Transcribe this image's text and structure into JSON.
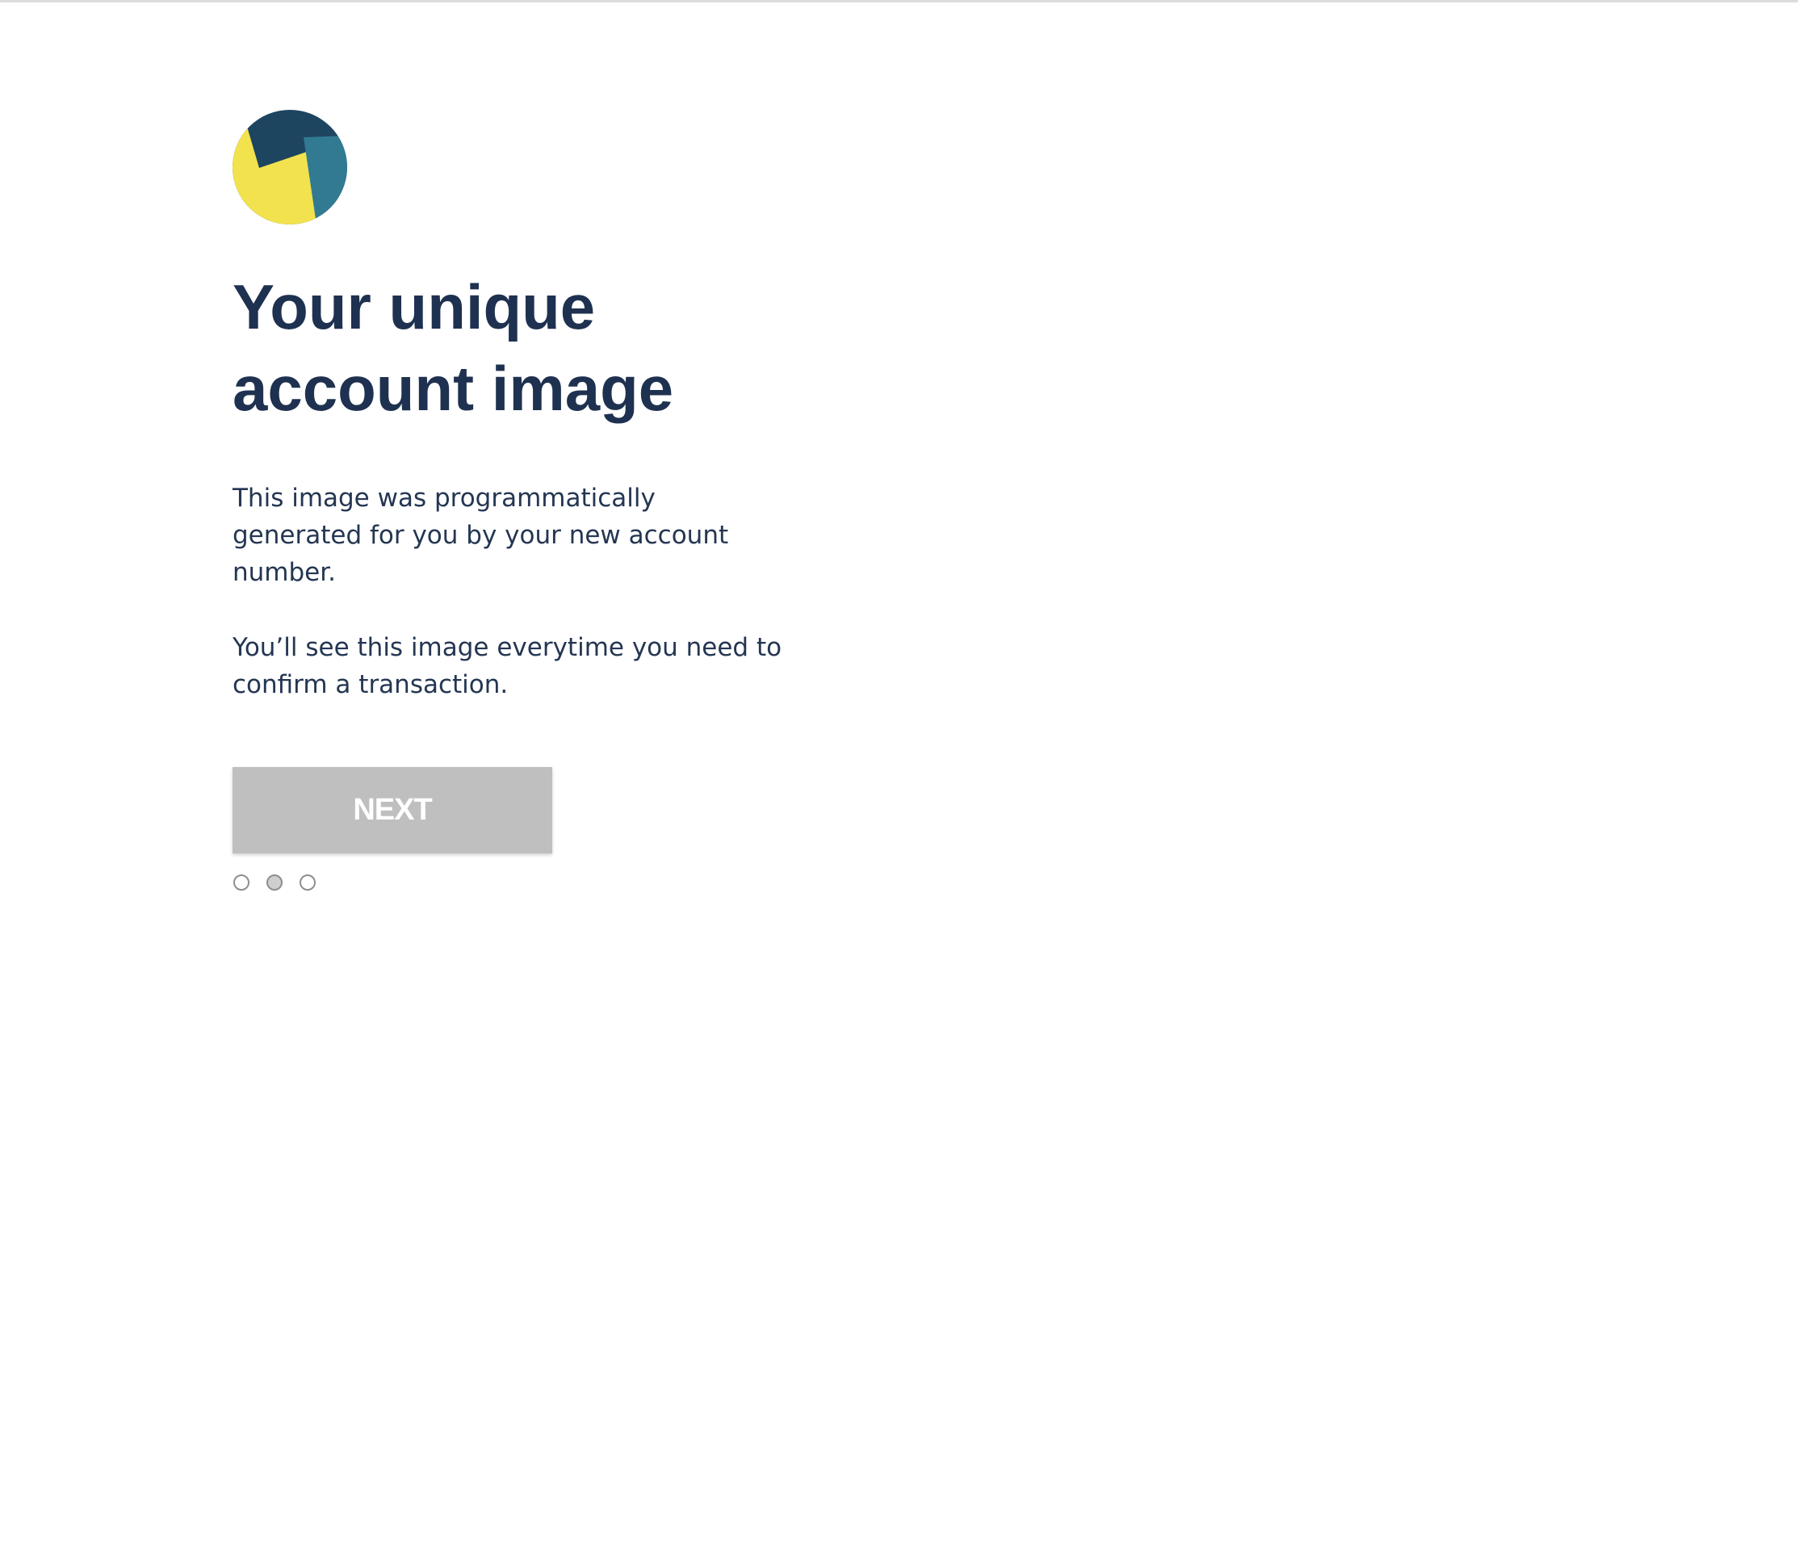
{
  "avatar": {
    "icon": "account-identicon",
    "colors": {
      "navy": "#1e4560",
      "teal": "#327a92",
      "yellow": "#f2e24d"
    }
  },
  "heading": {
    "line1": "Your unique",
    "line2": "account image"
  },
  "body": {
    "paragraph1_line1": "This image was programmatically",
    "paragraph1_line2": "generated for you by your new account",
    "paragraph1_line3": "number.",
    "paragraph2_line1": "You’ll see this image everytime you need to",
    "paragraph2_line2": "confirm a transaction."
  },
  "next_button": {
    "label": "NEXT",
    "color": "#bfbfbf"
  },
  "pagination": {
    "total": 3,
    "current": 2
  }
}
